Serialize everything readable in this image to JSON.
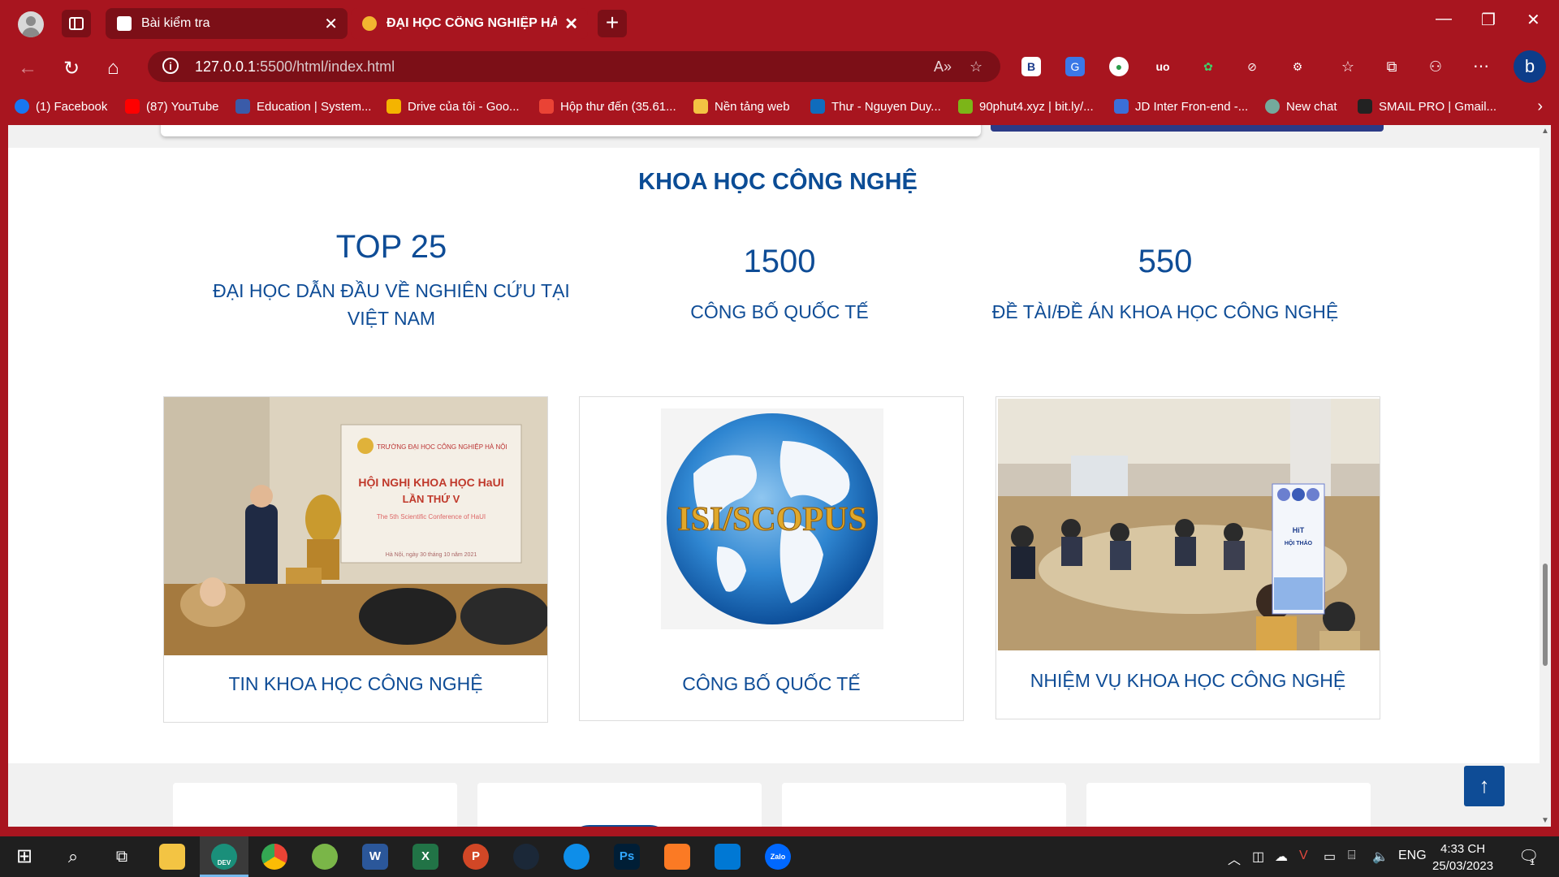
{
  "tabs": [
    {
      "title": "Bài kiểm tra"
    },
    {
      "title": "ĐẠI HỌC CÔNG NGHIỆP HÀ NỘI"
    }
  ],
  "address": {
    "host": "127.0.0.1",
    "path": ":5500/html/index.html"
  },
  "bookmarks": [
    {
      "label": "(1) Facebook",
      "color": "#1877f2"
    },
    {
      "label": "(87) YouTube",
      "color": "#ff0000"
    },
    {
      "label": "Education | System...",
      "color": "#3a5ba9"
    },
    {
      "label": "Drive của tôi - Goo...",
      "color": "#f4b400"
    },
    {
      "label": "Hộp thư đến (35.61...",
      "color": "#ea4335"
    },
    {
      "label": "Nền tảng web",
      "color": "#f3c443"
    },
    {
      "label": "Thư - Nguyen Duy...",
      "color": "#0f6cbd"
    },
    {
      "label": "90phut4.xyz | bit.ly/...",
      "color": "#7cb518"
    },
    {
      "label": "JD Inter Fron-end -...",
      "color": "#3b6fd8"
    },
    {
      "label": "New chat",
      "color": "#74aa9c"
    },
    {
      "label": "SMAIL PRO | Gmail...",
      "color": "#222222"
    }
  ],
  "section": {
    "title": "KHOA HỌC CÔNG NGHỆ",
    "stats": [
      {
        "number": "TOP 25",
        "label_line1": "ĐẠI HỌC DẪN ĐẦU VỀ NGHIÊN CỨU TẠI",
        "label_line2": "VIỆT NAM"
      },
      {
        "number": "1500",
        "label_line1": "CÔNG BỐ QUỐC TẾ"
      },
      {
        "number": "550",
        "label_line1": "ĐỀ TÀI/ĐỀ ÁN KHOA HỌC CÔNG NGHỆ"
      }
    ],
    "cards": [
      {
        "caption": "TIN KHOA HỌC CÔNG NGHỆ",
        "image_text": [
          "TRƯỜNG ĐẠI HỌC CÔNG NGHIỆP HÀ NỘI",
          "HỘI NGHỊ KHOA HỌC HaUI",
          "LẦN THỨ V",
          "The 5th Scientific Conference of HaUI",
          "Hà Nội, ngày 30 tháng 10 năm 2021"
        ]
      },
      {
        "caption": "CÔNG BỐ QUỐC TẾ",
        "image_text": [
          "ISI/SCOPUS"
        ]
      },
      {
        "caption": "NHIỆM VỤ KHOA HỌC CÔNG NGHỆ",
        "image_text": [
          "HiT",
          "HỘI THẢO"
        ]
      }
    ]
  },
  "taskbar": {
    "lang": "ENG",
    "time": "4:33 CH",
    "date": "25/03/2023",
    "apps": [
      "File Explorer",
      "Edge Dev",
      "Chrome",
      "Coc Coc",
      "Word",
      "Excel",
      "PowerPoint",
      "Steam",
      "TeamViewer",
      "Photoshop",
      "XAMPP",
      "VS Code",
      "Zalo"
    ],
    "app_glyphs": [
      "",
      "DEV",
      "",
      "",
      "W",
      "X",
      "P",
      "",
      "",
      "Ps",
      "",
      "",
      "Zalo"
    ],
    "notif_count": "1"
  },
  "colors": {
    "browser": "#a8151f",
    "brand_blue": "#0e4c96"
  }
}
